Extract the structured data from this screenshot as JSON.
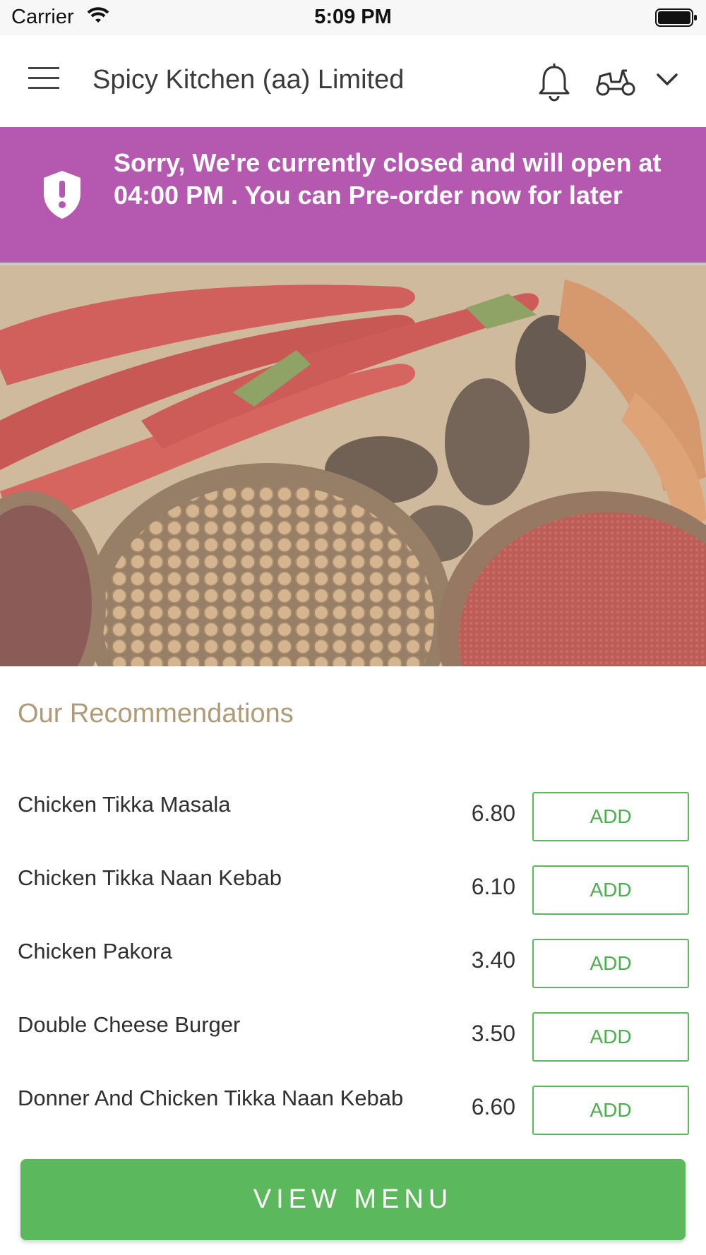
{
  "status_bar": {
    "carrier": "Carrier",
    "time": "5:09 PM"
  },
  "header": {
    "title": "Spicy Kitchen (aa) Limited"
  },
  "banner": {
    "message": "Sorry, We're currently closed and will open at 04:00 PM . You can Pre-order now for later",
    "color": "#b558b0"
  },
  "recommendations": {
    "title": "Our Recommendations",
    "items": [
      {
        "name": "Chicken Tikka Masala",
        "price": "6.80",
        "action": "ADD"
      },
      {
        "name": "Chicken Tikka Naan Kebab",
        "price": "6.10",
        "action": "ADD"
      },
      {
        "name": "Chicken Pakora",
        "price": "3.40",
        "action": "ADD"
      },
      {
        "name": "Double Cheese Burger",
        "price": "3.50",
        "action": "ADD"
      },
      {
        "name": "Donner And Chicken Tikka Naan Kebab",
        "price": "6.60",
        "action": "ADD"
      }
    ]
  },
  "view_menu": {
    "label": "VIEW MENU",
    "color": "#5cb85c"
  },
  "icons": {
    "menu": "hamburger-icon",
    "notifications": "bell-icon",
    "order_type": "scooter-icon",
    "dropdown": "chevron-down-icon",
    "banner": "shield-alert-icon"
  }
}
